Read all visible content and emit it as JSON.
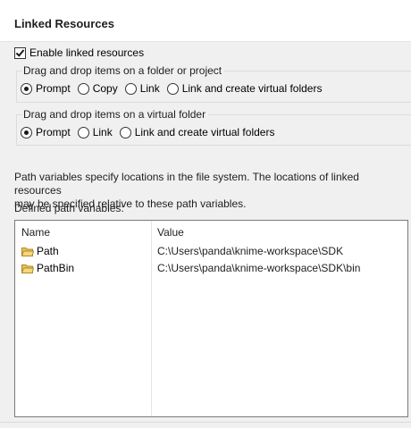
{
  "header": {
    "title": "Linked Resources"
  },
  "enable_linked": {
    "label": "Enable linked resources",
    "checked": true
  },
  "folder_group": {
    "label": "Drag and drop items on a folder or project",
    "options": [
      {
        "label": "Prompt",
        "selected": true
      },
      {
        "label": "Copy",
        "selected": false
      },
      {
        "label": "Link",
        "selected": false
      },
      {
        "label": "Link and create virtual folders",
        "selected": false
      }
    ]
  },
  "virtual_group": {
    "label": "Drag and drop items on a virtual folder",
    "options": [
      {
        "label": "Prompt",
        "selected": true
      },
      {
        "label": "Link",
        "selected": false
      },
      {
        "label": "Link and create virtual folders",
        "selected": false
      }
    ]
  },
  "description": {
    "line1": "Path variables specify locations in the file system. The locations of linked resources",
    "line2": "may be specified relative to these path variables."
  },
  "path_variables": {
    "label": "Defined path variables:",
    "columns": [
      "Name",
      "Value"
    ],
    "rows": [
      {
        "name": "Path",
        "value": "C:\\Users\\panda\\knime-workspace\\SDK",
        "icon": "folder-icon"
      },
      {
        "name": "PathBin",
        "value": "C:\\Users\\panda\\knime-workspace\\SDK\\bin",
        "icon": "folder-icon"
      }
    ]
  },
  "colors": {
    "folder_fill": "#e8c35a",
    "folder_stroke": "#b08a2a",
    "border": "#7a7a7a",
    "panel_bg": "#f0f0f0"
  }
}
